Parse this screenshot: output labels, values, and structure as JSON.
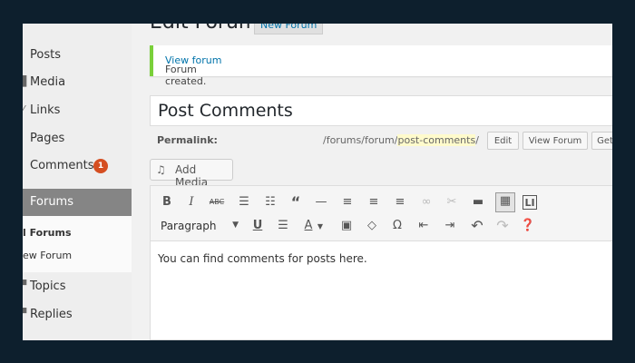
{
  "sidebar": {
    "items": [
      {
        "label": "Posts",
        "icon": "posts-icon"
      },
      {
        "label": "Media",
        "icon": "media-icon"
      },
      {
        "label": "Links",
        "icon": "links-icon"
      },
      {
        "label": "Pages",
        "icon": "pages-icon"
      },
      {
        "label": "Comments",
        "badge": "1",
        "icon": "comments-icon"
      },
      {
        "label": "Forums",
        "icon": "forums-icon"
      },
      {
        "label": "Topics",
        "icon": "topics-icon"
      },
      {
        "label": "Replies",
        "icon": "replies-icon"
      }
    ],
    "submenu": [
      "l Forums",
      "ew Forum"
    ]
  },
  "header": {
    "title": "Edit Forum",
    "new_button": "New Forum"
  },
  "notice": {
    "text": "Forum created.",
    "link": "View forum",
    "accent": "#7ad03a"
  },
  "title_field": {
    "value": "Post Comments"
  },
  "permalink": {
    "label": "Permalink:",
    "prefix": "/forums/forum/",
    "slug": "post-comments",
    "suffix": "/",
    "edit_button": "Edit",
    "view_button": "View Forum",
    "get_button": "Get"
  },
  "add_media": {
    "label": "Add Media"
  },
  "toolbar": {
    "row1": [
      "bold-icon",
      "italic-icon",
      "strikethrough-icon",
      "bullet-list-icon",
      "numbered-list-icon",
      "blockquote-icon",
      "horizontal-rule-icon",
      "align-left-icon",
      "align-center-icon",
      "align-right-icon",
      "link-icon",
      "unlink-icon",
      "read-more-icon",
      "toolbar-toggle-icon",
      "distraction-free-icon"
    ],
    "row2": [
      "underline-icon",
      "justify-icon",
      "text-color-icon",
      "paste-text-icon",
      "clear-formatting-icon",
      "special-character-icon",
      "outdent-icon",
      "indent-icon",
      "undo-icon",
      "redo-icon",
      "help-icon"
    ],
    "format_select": "Paragraph"
  },
  "editor": {
    "content": "You can find comments for posts here."
  },
  "colors": {
    "frame_bg": "#0d1f2d",
    "badge": "#d54e21",
    "link": "#0073aa",
    "active_menu": "#858585"
  }
}
